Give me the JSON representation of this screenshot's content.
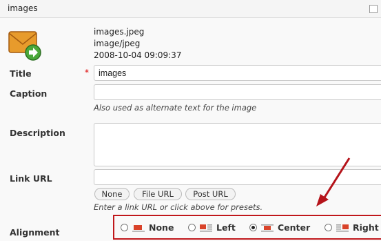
{
  "header": {
    "title": "images"
  },
  "media": {
    "filename": "images.jpeg",
    "mime_type": "image/jpeg",
    "date": "2008-10-04 09:09:37",
    "icon": "file-download-icon"
  },
  "fields": {
    "title": {
      "label": "Title",
      "required_mark": "*",
      "value": "images"
    },
    "caption": {
      "label": "Caption",
      "value": "",
      "help": "Also used as alternate text for the image"
    },
    "description": {
      "label": "Description",
      "value": ""
    },
    "link_url": {
      "label": "Link URL",
      "value": "",
      "buttons": [
        "None",
        "File URL",
        "Post URL"
      ],
      "help": "Enter a link URL or click above for presets."
    },
    "alignment": {
      "label": "Alignment",
      "options": [
        "None",
        "Left",
        "Center",
        "Right"
      ],
      "selected": "Center"
    }
  },
  "colors": {
    "annotation": "#c0171b",
    "required": "#dd0000",
    "icon_accent": "#e05a2b"
  }
}
